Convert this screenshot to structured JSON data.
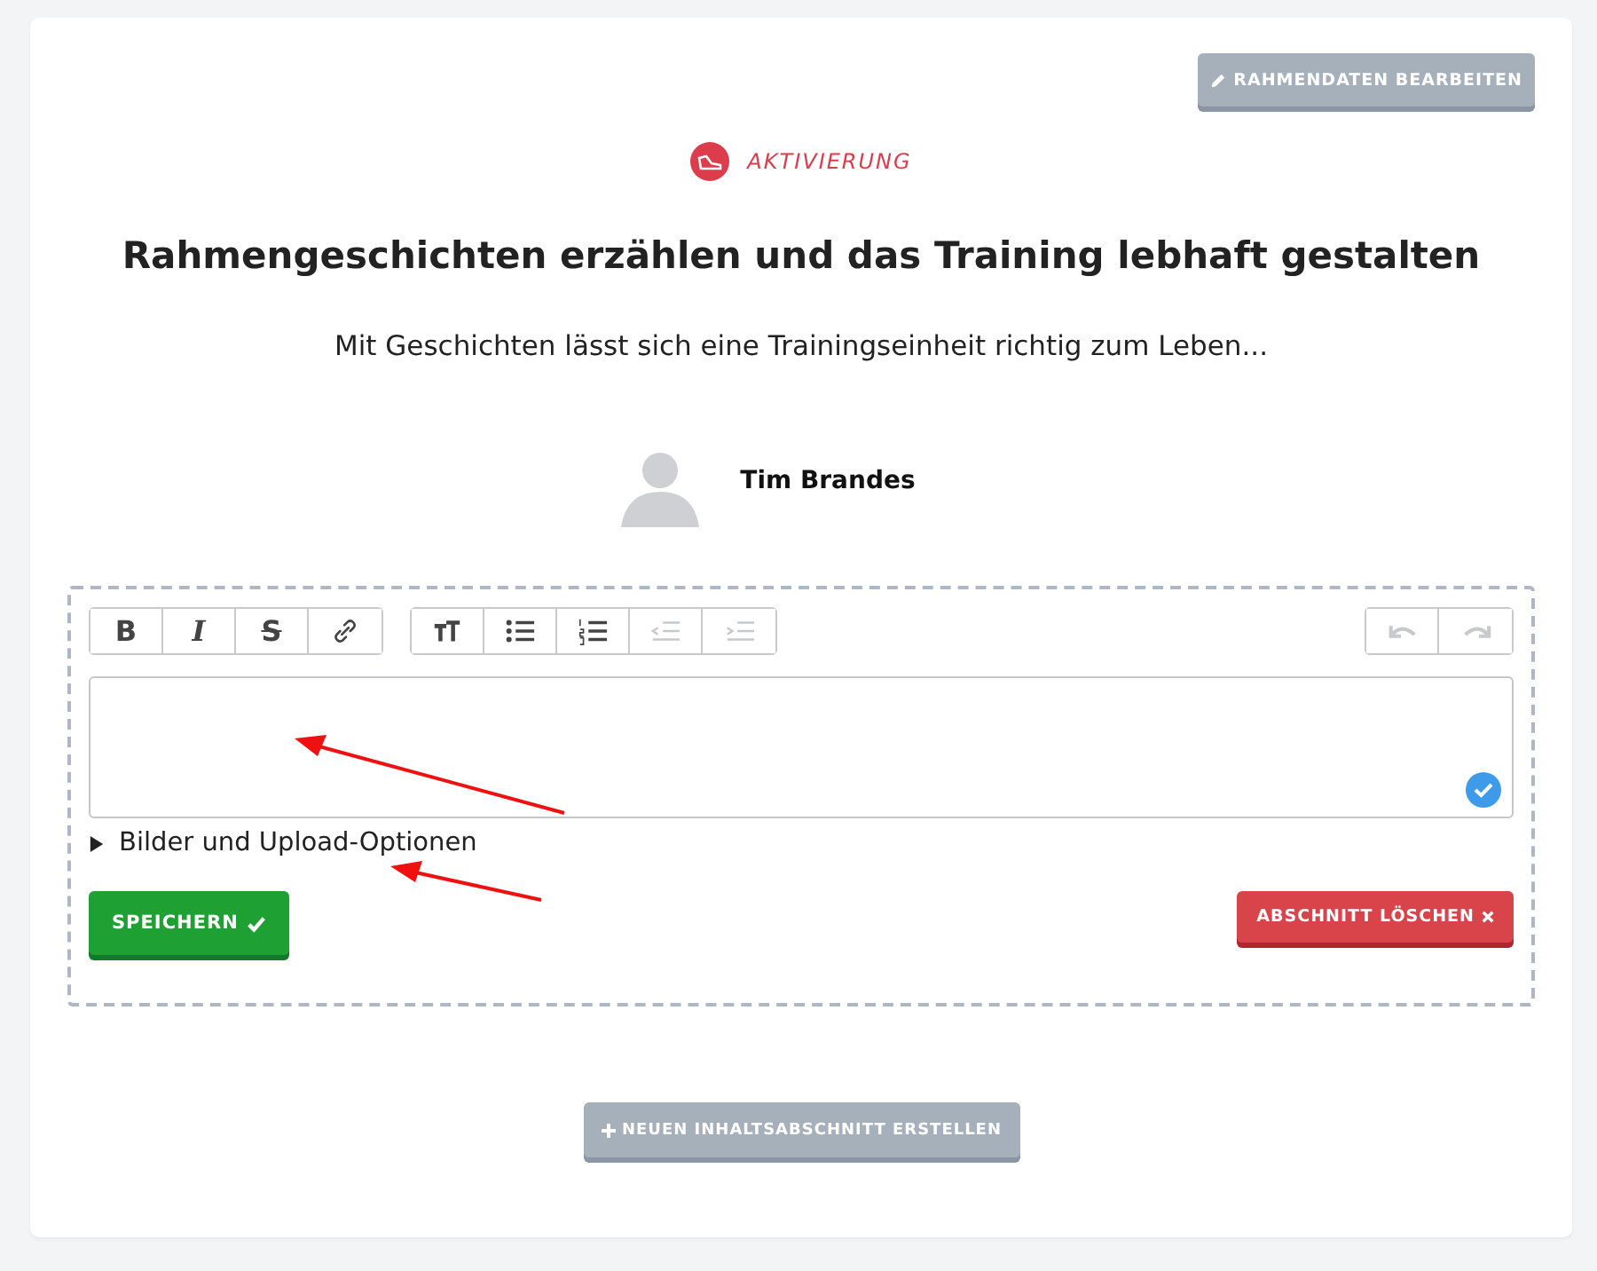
{
  "edit_button": {
    "label": "RAHMENDATEN BEARBEITEN"
  },
  "category": {
    "label": "AKTIVIERUNG"
  },
  "title": "Rahmengeschichten erzählen und das Training lebhaft gestalten",
  "subtitle": "Mit Geschichten lässt sich eine Trainingseinheit richtig zum Leben...",
  "author": {
    "name": "Tim Brandes"
  },
  "editor": {
    "toolbar": [
      [
        {
          "kind": "bold",
          "label": "B",
          "disabled": false
        },
        {
          "kind": "italic",
          "label": "I",
          "disabled": false
        },
        {
          "kind": "strike",
          "label": "S",
          "disabled": false
        },
        {
          "kind": "link",
          "disabled": false
        }
      ],
      [
        {
          "kind": "heading",
          "disabled": false
        },
        {
          "kind": "bullets",
          "disabled": false
        },
        {
          "kind": "numbers",
          "disabled": false
        },
        {
          "kind": "outdent",
          "disabled": true
        },
        {
          "kind": "indent",
          "disabled": true
        }
      ],
      [
        {
          "kind": "undo",
          "disabled": true
        },
        {
          "kind": "redo",
          "disabled": true
        }
      ]
    ],
    "valid": true,
    "details": {
      "label": "Bilder und Upload-Optionen",
      "expanded": false
    },
    "save_button": {
      "label": "SPEICHERN"
    },
    "delete_button": {
      "label": "ABSCHNITT LÖSCHEN"
    }
  },
  "new_section_button": {
    "label": "NEUEN INHALTSABSCHNITT ERSTELLEN"
  }
}
